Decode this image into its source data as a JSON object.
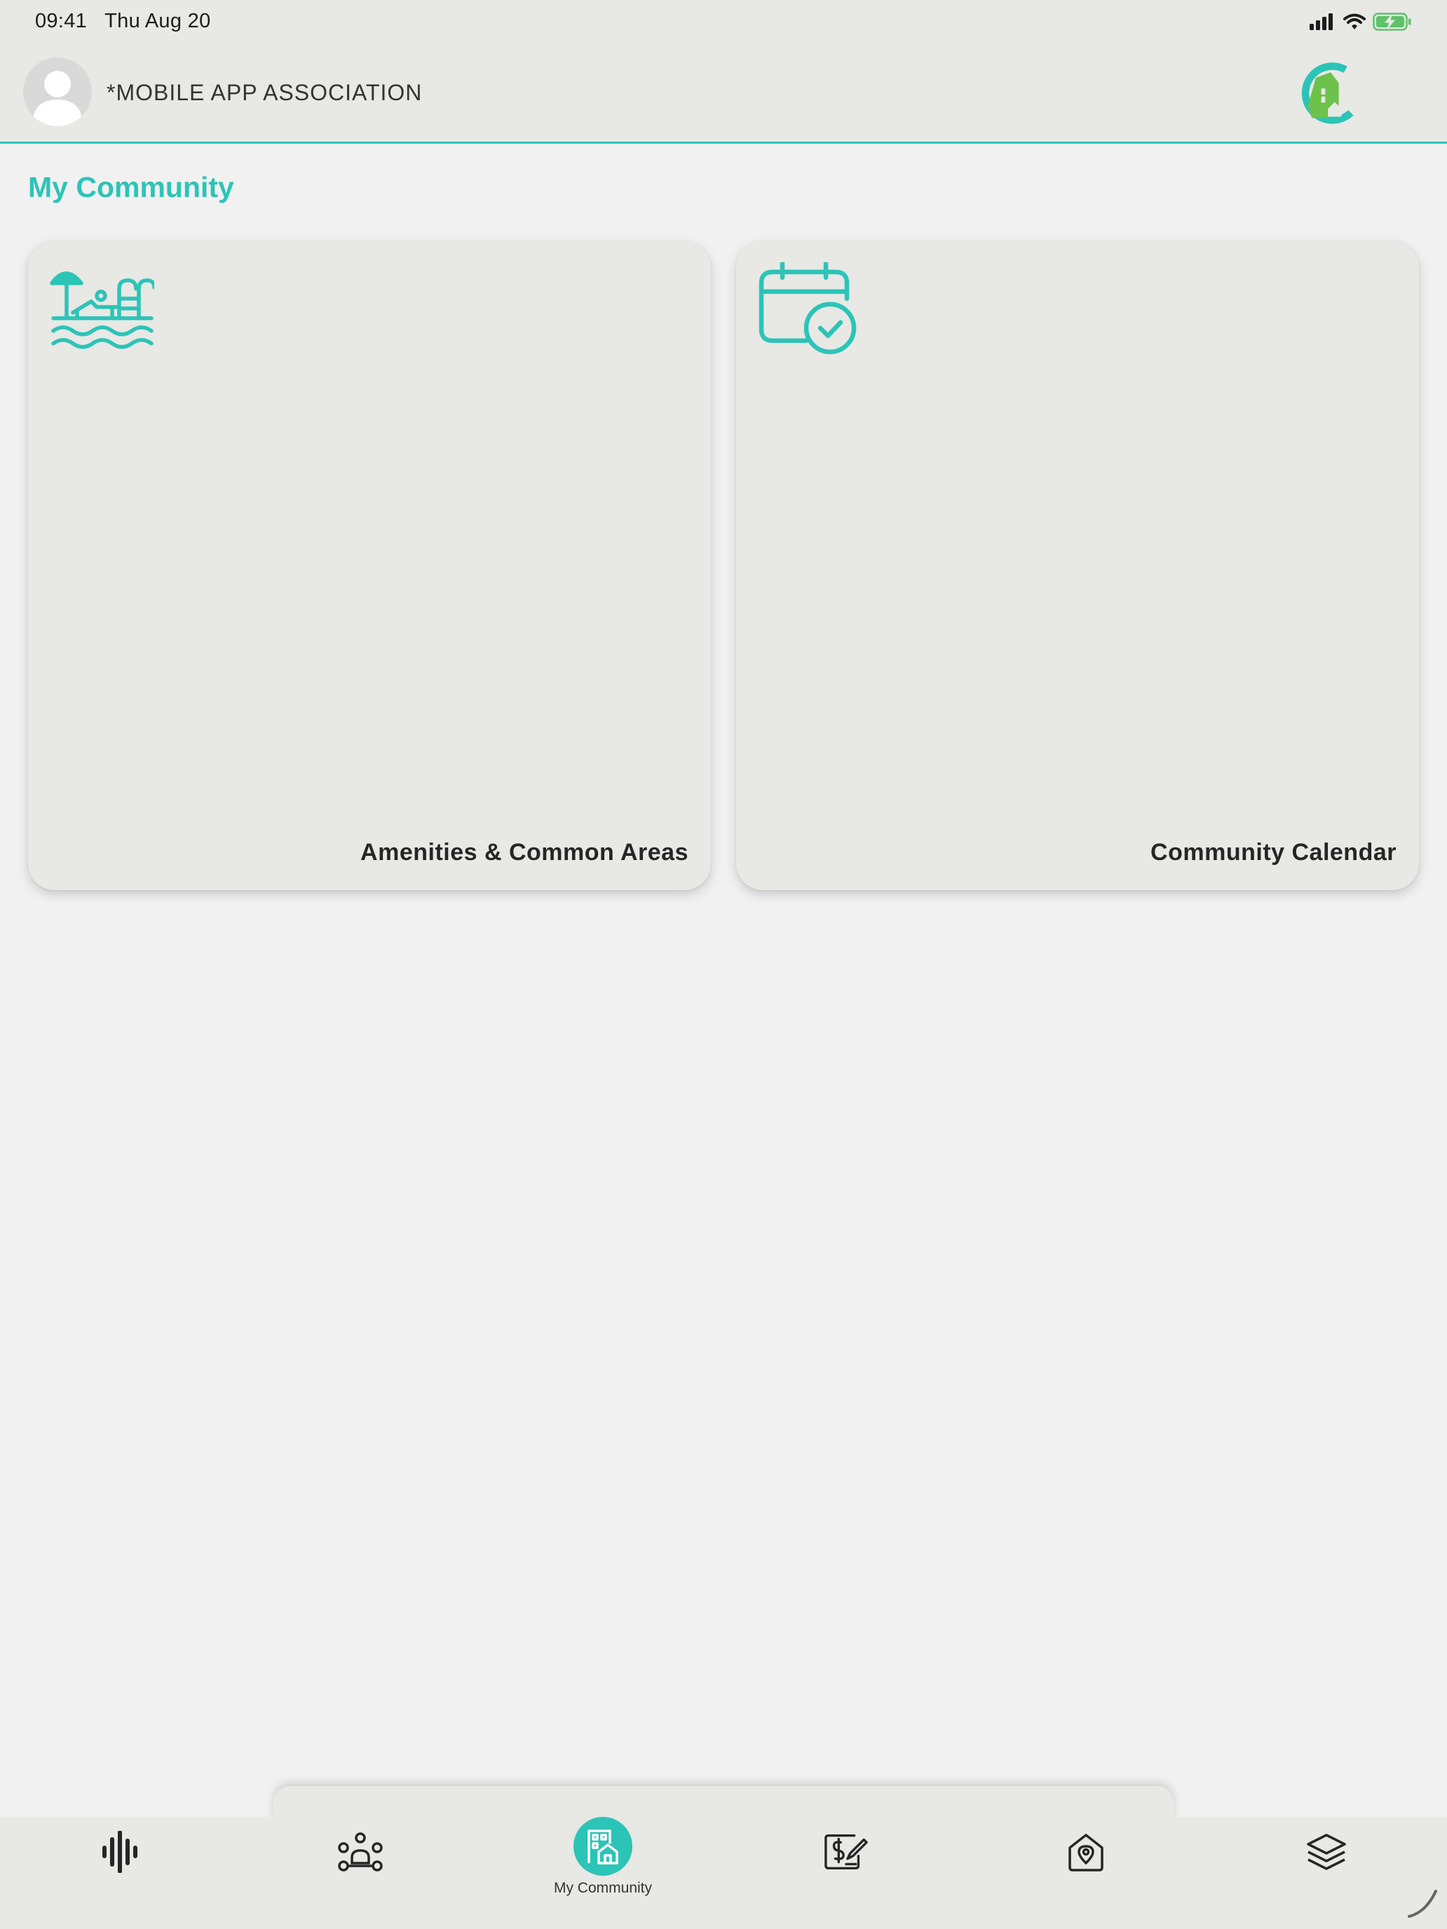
{
  "status_bar": {
    "time": "09:41",
    "date": "Thu Aug 20",
    "icons": [
      "signal-icon",
      "wifi-icon",
      "battery-charging-icon"
    ]
  },
  "header": {
    "association_name": "*MOBILE APP ASSOCIATION",
    "avatar_icon": "person-icon",
    "logo_icon": "brand-logo"
  },
  "page": {
    "title": "My Community"
  },
  "cards": [
    {
      "label": "Amenities & Common Areas",
      "icon": "pool-icon"
    },
    {
      "label": "Community Calendar",
      "icon": "calendar-check-icon"
    }
  ],
  "bottom_nav": {
    "items": [
      {
        "icon": "activity-icon",
        "label": ""
      },
      {
        "icon": "people-network-icon",
        "label": ""
      },
      {
        "icon": "community-building-icon",
        "label": "My Community",
        "active": true
      },
      {
        "icon": "payment-edit-icon",
        "label": ""
      },
      {
        "icon": "home-location-icon",
        "label": ""
      },
      {
        "icon": "layers-icon",
        "label": ""
      }
    ]
  },
  "colors": {
    "accent": "#2cc4b7",
    "logo_green": "#6cc24a",
    "background": "#f1f1f1",
    "surface": "#e8e8e5",
    "text_dark": "#262626"
  }
}
